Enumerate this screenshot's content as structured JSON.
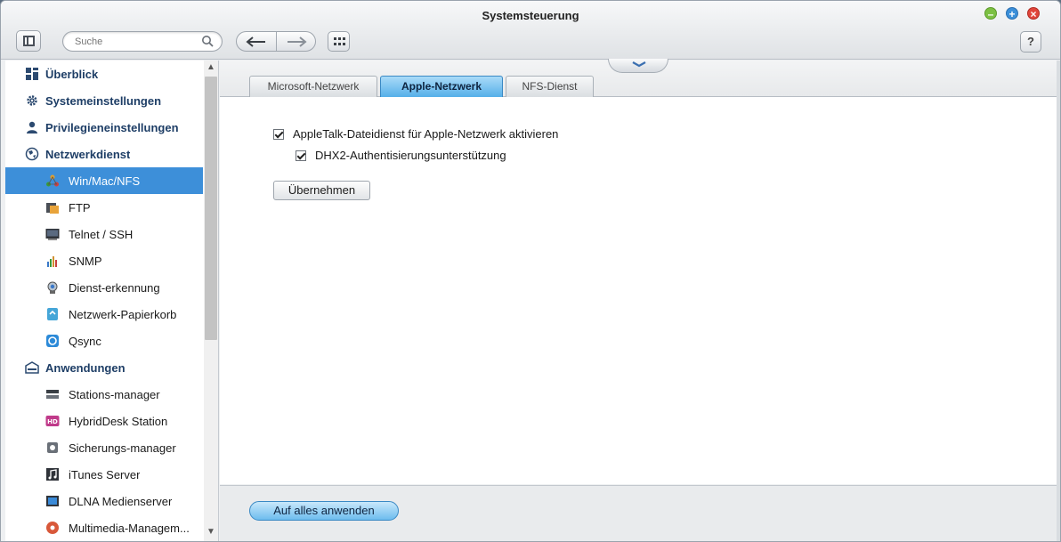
{
  "window": {
    "title": "Systemsteuerung",
    "controls": {
      "minimize": "–",
      "maximize": "+",
      "close": "×"
    }
  },
  "toolbar": {
    "search_placeholder": "Suche",
    "help_label": "?"
  },
  "sidebar": {
    "items": [
      {
        "label": "Überblick",
        "kind": "category",
        "icon": "overview-grid-icon"
      },
      {
        "label": "Systemeinstellungen",
        "kind": "category",
        "icon": "gear-icon"
      },
      {
        "label": "Privilegieneinstellungen",
        "kind": "category",
        "icon": "user-icon"
      },
      {
        "label": "Netzwerkdienst",
        "kind": "category",
        "icon": "globe-icon"
      },
      {
        "label": "Win/Mac/NFS",
        "kind": "sub",
        "icon": "network-share-icon",
        "active": true
      },
      {
        "label": "FTP",
        "kind": "sub",
        "icon": "ftp-icon"
      },
      {
        "label": "Telnet / SSH",
        "kind": "sub",
        "icon": "terminal-icon"
      },
      {
        "label": "SNMP",
        "kind": "sub",
        "icon": "snmp-chart-icon"
      },
      {
        "label": "Dienst-erkennung",
        "kind": "sub",
        "icon": "service-discovery-icon"
      },
      {
        "label": "Netzwerk-Papierkorb",
        "kind": "sub",
        "icon": "recycle-bin-icon"
      },
      {
        "label": "Qsync",
        "kind": "sub",
        "icon": "qsync-icon"
      },
      {
        "label": "Anwendungen",
        "kind": "category",
        "icon": "applications-icon"
      },
      {
        "label": "Stations-manager",
        "kind": "sub",
        "icon": "station-manager-icon"
      },
      {
        "label": "HybridDesk Station",
        "kind": "sub",
        "icon": "hybriddesk-icon"
      },
      {
        "label": "Sicherungs-manager",
        "kind": "sub",
        "icon": "backup-manager-icon"
      },
      {
        "label": "iTunes Server",
        "kind": "sub",
        "icon": "itunes-icon"
      },
      {
        "label": "DLNA Medienserver",
        "kind": "sub",
        "icon": "dlna-icon"
      },
      {
        "label": "Multimedia-Managem...",
        "kind": "sub",
        "icon": "multimedia-icon"
      }
    ]
  },
  "tabs": [
    {
      "label": "Microsoft-Netzwerk",
      "active": false
    },
    {
      "label": "Apple-Netzwerk",
      "active": true
    },
    {
      "label": "NFS-Dienst",
      "active": false
    }
  ],
  "content": {
    "appletalk_label": "AppleTalk-Dateidienst für Apple-Netzwerk aktivieren",
    "appletalk_checked": true,
    "dhx2_label": "DHX2-Authentisierungsunterstützung",
    "dhx2_checked": true,
    "apply_label": "Übernehmen"
  },
  "footer": {
    "apply_all_label": "Auf alles anwenden"
  },
  "colors": {
    "accent": "#3d8fd9",
    "category_text": "#1e3e66"
  }
}
